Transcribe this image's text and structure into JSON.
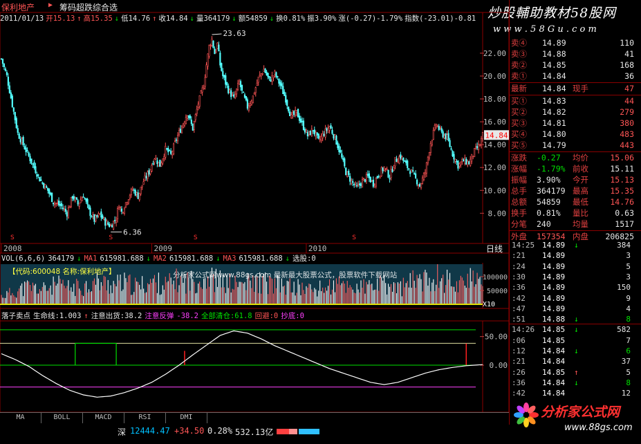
{
  "header": {
    "stock_name": "保利地产",
    "marker": "▶",
    "formula_name": "筹码超跌综合选"
  },
  "info_bar": [
    {
      "text": "2011/01/13",
      "color": "#e8e8e8"
    },
    {
      "text": "开15.13",
      "color": "#ff5555"
    },
    {
      "text": "↑",
      "color": "#ff5555"
    },
    {
      "text": "高15.35",
      "color": "#ff5555"
    },
    {
      "text": "↓",
      "color": "#00e000"
    },
    {
      "text": "低14.76",
      "color": "#e8e8e8"
    },
    {
      "text": "↑",
      "color": "#ff5555"
    },
    {
      "text": "收14.84",
      "color": "#e8e8e8"
    },
    {
      "text": "↓",
      "color": "#00e000"
    },
    {
      "text": "量364179",
      "color": "#e8e8e8"
    },
    {
      "text": "↓",
      "color": "#00e000"
    },
    {
      "text": "额54859",
      "color": "#e8e8e8"
    },
    {
      "text": "↓",
      "color": "#00e000"
    },
    {
      "text": "换0.81%",
      "color": "#e8e8e8"
    },
    {
      "text": "振3.90%",
      "color": "#e8e8e8"
    },
    {
      "text": "涨(-0.27)-1.79%",
      "color": "#e8e8e8"
    },
    {
      "text": "指数(-23.01)-0.81",
      "color": "#e8e8e8"
    }
  ],
  "watermark_top": "炒股輔助教材58股网",
  "watermark_url": "w w w . 5 8 G u . c o m",
  "chart_data": [
    {
      "type": "candlestick",
      "title": "保利地产",
      "y_ticks": [
        22.0,
        20.0,
        18.0,
        16.0,
        14.0,
        12.0,
        10.0,
        8.0
      ],
      "ylim": [
        5.6,
        25.2
      ],
      "x_labels": [
        "2008",
        "2009",
        "2010"
      ],
      "annotations": [
        {
          "text": "23.63",
          "value": 23.63
        },
        {
          "text": "6.36",
          "value": 6.36
        },
        {
          "text": "14.84",
          "value": 14.84
        }
      ],
      "period_label": "日线",
      "signal_marks": [
        "S",
        "S",
        "S",
        "S"
      ],
      "close_path": [
        [
          0,
          21.5
        ],
        [
          4,
          20.0
        ],
        [
          8,
          17.5
        ],
        [
          12,
          15.0
        ],
        [
          18,
          13.5
        ],
        [
          24,
          12.0
        ],
        [
          28,
          11.0
        ],
        [
          34,
          10.0
        ],
        [
          38,
          9.0
        ],
        [
          44,
          8.6
        ],
        [
          48,
          8.0
        ],
        [
          52,
          9.5
        ],
        [
          56,
          8.8
        ],
        [
          60,
          9.6
        ],
        [
          64,
          8.2
        ],
        [
          68,
          7.4
        ],
        [
          72,
          7.9
        ],
        [
          76,
          7.2
        ],
        [
          80,
          6.9
        ],
        [
          84,
          7.6
        ],
        [
          86,
          8.8
        ],
        [
          88,
          8.1
        ],
        [
          92,
          9.2
        ],
        [
          96,
          10.1
        ],
        [
          100,
          9.5
        ],
        [
          104,
          10.8
        ],
        [
          108,
          11.6
        ],
        [
          112,
          12.9
        ],
        [
          116,
          12.2
        ],
        [
          120,
          13.6
        ],
        [
          124,
          13.1
        ],
        [
          128,
          14.5
        ],
        [
          132,
          15.6
        ],
        [
          136,
          16.8
        ],
        [
          140,
          15.4
        ],
        [
          144,
          17.6
        ],
        [
          148,
          19.2
        ],
        [
          150,
          21.0
        ],
        [
          152,
          22.6
        ],
        [
          154,
          23.2
        ],
        [
          156,
          22.0
        ],
        [
          158,
          22.8
        ],
        [
          160,
          21.0
        ],
        [
          162,
          20.0
        ],
        [
          166,
          18.8
        ],
        [
          170,
          18.0
        ],
        [
          174,
          19.5
        ],
        [
          176,
          18.6
        ],
        [
          180,
          17.3
        ],
        [
          184,
          18.2
        ],
        [
          188,
          19.8
        ],
        [
          192,
          20.6
        ],
        [
          196,
          19.6
        ],
        [
          200,
          20.2
        ],
        [
          204,
          19.2
        ],
        [
          208,
          18.0
        ],
        [
          212,
          16.4
        ],
        [
          216,
          16.8
        ],
        [
          220,
          15.8
        ],
        [
          224,
          14.8
        ],
        [
          228,
          15.3
        ],
        [
          232,
          14.3
        ],
        [
          236,
          15.0
        ],
        [
          240,
          15.6
        ],
        [
          244,
          14.6
        ],
        [
          248,
          13.2
        ],
        [
          252,
          11.6
        ],
        [
          256,
          10.8
        ],
        [
          260,
          10.2
        ],
        [
          264,
          10.8
        ],
        [
          268,
          11.2
        ],
        [
          272,
          10.6
        ],
        [
          276,
          11.4
        ],
        [
          280,
          12.0
        ],
        [
          284,
          11.2
        ],
        [
          288,
          12.6
        ],
        [
          292,
          13.0
        ],
        [
          296,
          12.2
        ],
        [
          300,
          11.6
        ],
        [
          304,
          10.8
        ],
        [
          306,
          10.4
        ],
        [
          310,
          11.6
        ],
        [
          314,
          14.2
        ],
        [
          318,
          15.8
        ],
        [
          322,
          15.0
        ],
        [
          326,
          14.6
        ],
        [
          330,
          13.2
        ],
        [
          334,
          12.2
        ],
        [
          338,
          12.6
        ],
        [
          342,
          12.4
        ],
        [
          346,
          13.4
        ],
        [
          350,
          14.0
        ],
        [
          352,
          14.84
        ]
      ]
    },
    {
      "type": "bar",
      "title": "VOL(6,6,6)",
      "header": [
        {
          "text": "VOL(6,6,6)",
          "color": "#e8e8e8"
        },
        {
          "text": "364179",
          "color": "#e8e8e8"
        },
        {
          "text": "↓",
          "color": "#00e000"
        },
        {
          "text": "MA1",
          "color": "#ff5555"
        },
        {
          "text": "615981.688",
          "color": "#e8e8e8"
        },
        {
          "text": "↓",
          "color": "#00e000"
        },
        {
          "text": "MA2",
          "color": "#ff5555"
        },
        {
          "text": "615981.688",
          "color": "#e8e8e8"
        },
        {
          "text": "↓",
          "color": "#00e000"
        },
        {
          "text": "MA3",
          "color": "#ff5555"
        },
        {
          "text": "615981.688",
          "color": "#e8e8e8"
        },
        {
          "text": "↓",
          "color": "#00e000"
        },
        {
          "text": "选股:0",
          "color": "#e8e8e8"
        }
      ],
      "overlay_text": "【代码:600048 名称:保利地产】",
      "watermark": "分析家公式网www.88gs.com 最新最大股票公式，股票软件下载网站",
      "y_ticks": [
        "100000",
        "50000"
      ],
      "unit": "X10",
      "volume_profile": [
        [
          0,
          25
        ],
        [
          10,
          40
        ],
        [
          20,
          55
        ],
        [
          30,
          45
        ],
        [
          40,
          60
        ],
        [
          50,
          50
        ],
        [
          60,
          55
        ],
        [
          70,
          70
        ],
        [
          80,
          60
        ],
        [
          90,
          65
        ],
        [
          100,
          55
        ],
        [
          110,
          70
        ],
        [
          120,
          60
        ],
        [
          130,
          75
        ],
        [
          140,
          70
        ],
        [
          150,
          85
        ],
        [
          160,
          70
        ],
        [
          170,
          60
        ],
        [
          180,
          65
        ],
        [
          190,
          70
        ],
        [
          200,
          60
        ],
        [
          210,
          55
        ],
        [
          220,
          50
        ],
        [
          230,
          45
        ],
        [
          240,
          55
        ],
        [
          250,
          60
        ],
        [
          260,
          50
        ],
        [
          270,
          55
        ],
        [
          280,
          60
        ],
        [
          290,
          50
        ],
        [
          300,
          65
        ],
        [
          305,
          95
        ],
        [
          310,
          70
        ],
        [
          315,
          85
        ],
        [
          320,
          90
        ],
        [
          325,
          75
        ],
        [
          330,
          70
        ],
        [
          335,
          60
        ],
        [
          340,
          95
        ],
        [
          345,
          70
        ],
        [
          352,
          55
        ]
      ]
    },
    {
      "type": "line",
      "title": "落子卖点",
      "header": [
        {
          "text": "落子卖点",
          "color": "#e8e8e8"
        },
        {
          "text": "生命线:1.003",
          "color": "#e8e8e8"
        },
        {
          "text": "↑",
          "color": "#ff5555"
        },
        {
          "text": "注意出货:38.2",
          "color": "#e8e8e8"
        },
        {
          "text": "注意反弹",
          "color": "#ff40ff"
        },
        {
          "text": "-38.2",
          "color": "#ff40ff"
        },
        {
          "text": "全部清仓:61.8",
          "color": "#00e000"
        },
        {
          "text": "回避:0",
          "color": "#ff5555"
        },
        {
          "text": "抄底:0",
          "color": "#ff40ff"
        }
      ],
      "y_ticks": [
        "50.00",
        "0.00"
      ],
      "ylim": [
        -75,
        75
      ],
      "levels": [
        61.8,
        38.2,
        0,
        -38.2
      ],
      "life_line": [
        [
          0,
          20
        ],
        [
          10,
          10
        ],
        [
          20,
          -2
        ],
        [
          30,
          -18
        ],
        [
          40,
          -32
        ],
        [
          50,
          -44
        ],
        [
          60,
          -52
        ],
        [
          70,
          -56
        ],
        [
          80,
          -54
        ],
        [
          90,
          -48
        ],
        [
          100,
          -40
        ],
        [
          110,
          -30
        ],
        [
          120,
          -16
        ],
        [
          130,
          0
        ],
        [
          140,
          18
        ],
        [
          150,
          35
        ],
        [
          160,
          52
        ],
        [
          170,
          60
        ],
        [
          180,
          56
        ],
        [
          190,
          46
        ],
        [
          200,
          34
        ],
        [
          210,
          24
        ],
        [
          220,
          14
        ],
        [
          230,
          4
        ],
        [
          240,
          -6
        ],
        [
          250,
          -14
        ],
        [
          260,
          -22
        ],
        [
          270,
          -30
        ],
        [
          280,
          -34
        ],
        [
          290,
          -30
        ],
        [
          300,
          -22
        ],
        [
          310,
          -14
        ],
        [
          320,
          -8
        ],
        [
          330,
          -4
        ],
        [
          340,
          -1
        ],
        [
          352,
          1
        ]
      ],
      "green_box": [
        54,
        84,
        38.2
      ],
      "red_spikes": [
        [
          134,
          25
        ],
        [
          340,
          38
        ]
      ]
    }
  ],
  "quotes": {
    "sell": [
      {
        "label": "卖④",
        "price": "14.89",
        "vol": "110"
      },
      {
        "label": "卖③",
        "price": "14.88",
        "vol": "41"
      },
      {
        "label": "卖②",
        "price": "14.85",
        "vol": "168"
      },
      {
        "label": "卖①",
        "price": "14.84",
        "vol": "36"
      }
    ],
    "latest": {
      "label": "最新",
      "price": "14.84",
      "label2": "现手",
      "vol": "47"
    },
    "buy": [
      {
        "label": "买①",
        "price": "14.83",
        "vol": "44"
      },
      {
        "label": "买②",
        "price": "14.82",
        "vol": "279"
      },
      {
        "label": "买③",
        "price": "14.81",
        "vol": "380"
      },
      {
        "label": "买④",
        "price": "14.80",
        "vol": "483"
      },
      {
        "label": "买⑤",
        "price": "14.79",
        "vol": "443"
      }
    ],
    "stats": [
      {
        "l1": "涨跌",
        "v1": "-0.27",
        "l2": "均价",
        "v2": "15.06"
      },
      {
        "l1": "涨幅",
        "v1": "-1.79%",
        "l2": "前收",
        "v2": "15.11"
      },
      {
        "l1": "振幅",
        "v1": "3.90%",
        "l2": "今开",
        "v2": "15.13"
      },
      {
        "l1": "总手",
        "v1": "364179",
        "l2": "最高",
        "v2": "15.35"
      },
      {
        "l1": "总额",
        "v1": "54859",
        "l2": "最低",
        "v2": "14.76"
      },
      {
        "l1": "换手",
        "v1": "0.81%",
        "l2": "量比",
        "v2": "0.63"
      },
      {
        "l1": "分笔",
        "v1": "240",
        "l2": "均量",
        "v2": "1517"
      }
    ],
    "outer": {
      "label": "外盘",
      "value": "157354",
      "label2": "内盘",
      "value2": "206825"
    }
  },
  "ticks": [
    {
      "t": "14:25",
      "p": "14.89",
      "a": "↓",
      "v": "384"
    },
    {
      "t": ":21",
      "p": "14.89",
      "a": "",
      "v": "3"
    },
    {
      "t": ":24",
      "p": "14.89",
      "a": "",
      "v": "5"
    },
    {
      "t": ":30",
      "p": "14.89",
      "a": "",
      "v": "3"
    },
    {
      "t": ":36",
      "p": "14.89",
      "a": "",
      "v": "150"
    },
    {
      "t": ":42",
      "p": "14.89",
      "a": "",
      "v": "9"
    },
    {
      "t": ":47",
      "p": "14.89",
      "a": "",
      "v": "4"
    },
    {
      "t": ":51",
      "p": "14.88",
      "a": "↓",
      "v": "8"
    },
    {
      "t": "14:26",
      "p": "14.85",
      "a": "↓",
      "v": "582"
    },
    {
      "t": ":06",
      "p": "14.85",
      "a": "",
      "v": "7"
    },
    {
      "t": ":12",
      "p": "14.84",
      "a": "↓",
      "v": "6"
    },
    {
      "t": ":21",
      "p": "14.84",
      "a": "",
      "v": "37"
    },
    {
      "t": ":26",
      "p": "14.85",
      "a": "↑",
      "v": "5"
    },
    {
      "t": ":36",
      "p": "14.84",
      "a": "↓",
      "v": "8"
    },
    {
      "t": ":42",
      "p": "14.84",
      "a": "",
      "v": "12"
    }
  ],
  "tabs": [
    "MA",
    "BOLL",
    "MACD",
    "RSI",
    "DMI"
  ],
  "status": {
    "market": "深",
    "index": "12444.47",
    "change": "+34.50",
    "pct": "0.28%",
    "amount": "532.13亿"
  },
  "logo": {
    "text": "分析家公式网",
    "url": "www.88gs.com"
  }
}
